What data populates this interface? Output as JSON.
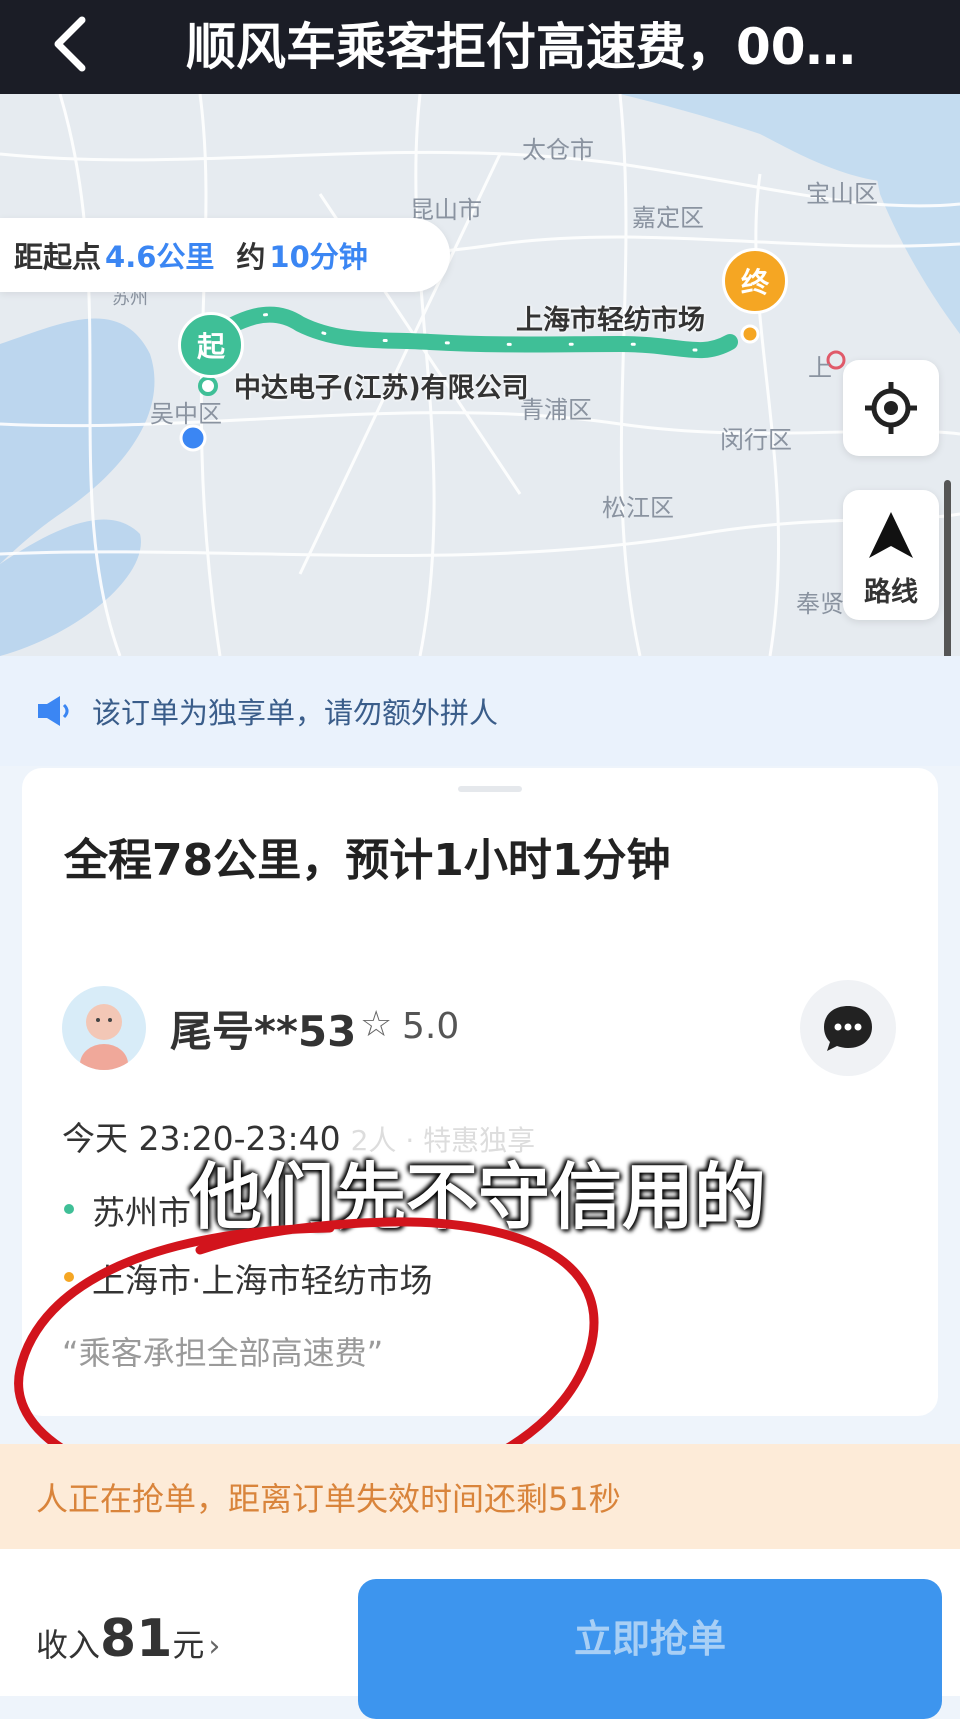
{
  "header": {
    "title": "顺风车乘客拒付高速费，00…"
  },
  "map": {
    "labels": {
      "taicang": "太仓市",
      "kunshan": "昆山市",
      "jiading": "嘉定区",
      "baoshan": "宝山区",
      "suzhou": "苏州",
      "wuzhong": "吴中区",
      "qingpu": "青浦区",
      "minhang": "闵行区",
      "songjiang": "松江区",
      "fengxian": "奉贤区",
      "shang": "上"
    },
    "distance_prefix": "距起点",
    "distance_value": "4.6公里",
    "time_prefix": "约",
    "time_value": "10分钟",
    "start_pin": "起",
    "end_pin": "终",
    "start_name": "中达电子(江苏)有限公司",
    "end_name": "上海市轻纺市场",
    "route_button_label": "路线"
  },
  "notice": {
    "text": "该订单为独享单，请勿额外拼人"
  },
  "order": {
    "summary": "全程78公里，预计1小时1分钟",
    "passenger": {
      "nickname": "尾号**53",
      "rating": "5.0"
    },
    "time_window": "今天 23:20-23:40",
    "tags": "2人 · 特惠独享",
    "from": "苏州市",
    "to": "上海市·上海市轻纺市场",
    "remark": "“乘客承担全部高速费”"
  },
  "subtitle_overlay": "他们先不守信用的",
  "grab_status": "人正在抢单，距离订单失效时间还剩51秒",
  "footer": {
    "income_prefix": "收入",
    "income_value": "81",
    "income_unit": "元",
    "income_arrow": "›",
    "grab_button": "立即抢单"
  },
  "colors": {
    "route": "#3fbf97",
    "accent": "#3b86f3",
    "end_pin": "#f5a623",
    "button": "#3d95ee",
    "annotation": "#d2141c"
  }
}
